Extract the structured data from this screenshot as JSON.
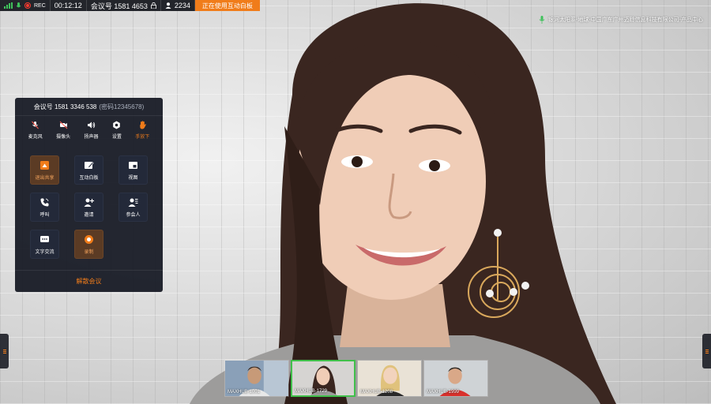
{
  "status_bar": {
    "rec_label": "REC",
    "elapsed_time": "00:12:12",
    "meeting_id_label": "会议号 1581 4653",
    "participant_count": "2234",
    "sharing_status": "正在使用互动白板"
  },
  "caption": {
    "text": "银河太阳系-地球-中国广东广州迈聆信息科技有限公司-产品中心"
  },
  "panel": {
    "meeting_number": "会议号 1581 3346 538",
    "password": "(密码12345678)",
    "quick_actions": [
      {
        "label": "麦克风",
        "icon": "mic-muted-icon"
      },
      {
        "label": "摄像头",
        "icon": "camera-off-icon"
      },
      {
        "label": "扬声器",
        "icon": "speaker-icon"
      },
      {
        "label": "设置",
        "icon": "settings-icon"
      },
      {
        "label": "手放下",
        "icon": "hand-icon",
        "active": true
      }
    ],
    "tiles": [
      {
        "label": "退出共享",
        "icon": "share-exit-icon",
        "highlight": true
      },
      {
        "label": "互动白板",
        "icon": "whiteboard-icon"
      },
      {
        "label": "视图",
        "icon": "view-icon"
      },
      {
        "label": "呼叫",
        "icon": "call-icon"
      },
      {
        "label": "邀请",
        "icon": "invite-icon"
      },
      {
        "label": "参会人",
        "icon": "participants-icon"
      },
      {
        "label": "文字交流",
        "icon": "chat-icon"
      },
      {
        "label": "录制",
        "icon": "record-icon",
        "highlight": true
      }
    ],
    "dismiss_label": "解散会议"
  },
  "participants": [
    {
      "name": "MAXHUB-1001"
    },
    {
      "name": "MAXHUB-1729",
      "active": true
    },
    {
      "name": "MAXHUB-1208"
    },
    {
      "name": "MAXHUB-1999"
    }
  ],
  "colors": {
    "accent": "#f07c1a",
    "active_border": "#41c04b",
    "signal": "#3fc15b",
    "record": "#ff3b30",
    "panel_bg": "#161a24"
  }
}
